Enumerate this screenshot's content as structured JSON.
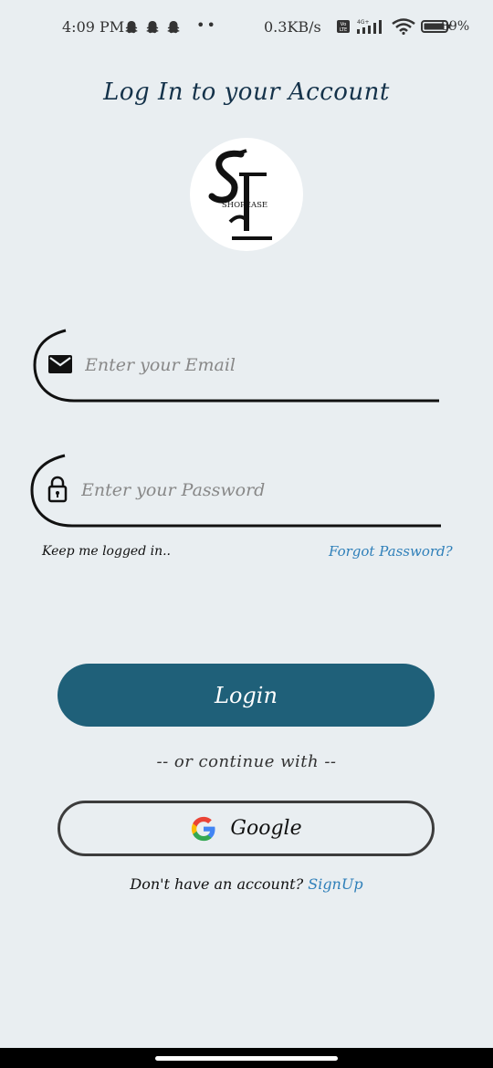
{
  "status_bar": {
    "time": "4:09 PM",
    "dots": "••",
    "network_speed": "0.3KB/s",
    "network_type": "4G+",
    "volte": "Vo LTE",
    "battery_percent": "89%",
    "icons": [
      "snapchat-ghost-icon",
      "snapchat-ghost-icon",
      "snapchat-ghost-icon",
      "volte-icon",
      "signal-icon",
      "wifi-icon",
      "battery-icon"
    ]
  },
  "page": {
    "title": "Log In to your Account"
  },
  "logo": {
    "letters": "SL",
    "wordmark": "SHOPEASE"
  },
  "form": {
    "email_placeholder": "Enter your Email",
    "password_placeholder": "Enter your Password",
    "email_value": "",
    "password_value": "",
    "email_icon": "mail-icon",
    "password_icon": "lock-icon"
  },
  "options": {
    "keep_logged_in": "Keep me logged in..",
    "forgot_password": "Forgot Password?"
  },
  "actions": {
    "login_label": "Login",
    "or_text": "-- or continue with --",
    "google_label": "Google",
    "google_icon": "google-logo-icon"
  },
  "signup": {
    "prompt": "Don't have an account?",
    "link": "SignUp"
  },
  "colors": {
    "background": "#e9eef1",
    "primary_button": "#1f6079",
    "link": "#2e7fb9",
    "title": "#14324a"
  }
}
